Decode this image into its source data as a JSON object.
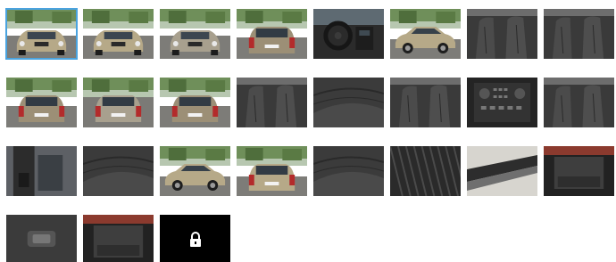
{
  "gallery": {
    "selected_index": 0,
    "thumbnails": [
      {
        "subject": "car-front-three-quarter",
        "scene": "exterior"
      },
      {
        "subject": "car-front-three-quarter",
        "scene": "exterior"
      },
      {
        "subject": "car-front",
        "scene": "exterior"
      },
      {
        "subject": "car-rear-three-quarter",
        "scene": "exterior"
      },
      {
        "subject": "dashboard-steering-wheel",
        "scene": "interior"
      },
      {
        "subject": "car-side-profile",
        "scene": "exterior"
      },
      {
        "subject": "rear-seats",
        "scene": "interior"
      },
      {
        "subject": "front-seats",
        "scene": "interior"
      },
      {
        "subject": "car-rear-three-quarter",
        "scene": "exterior"
      },
      {
        "subject": "car-rear",
        "scene": "exterior"
      },
      {
        "subject": "car-rear-three-quarter",
        "scene": "exterior"
      },
      {
        "subject": "cabin-from-rear",
        "scene": "interior"
      },
      {
        "subject": "door-seat-controls",
        "scene": "interior"
      },
      {
        "subject": "driver-seat",
        "scene": "interior"
      },
      {
        "subject": "center-console",
        "scene": "interior"
      },
      {
        "subject": "seats-closeup",
        "scene": "interior"
      },
      {
        "subject": "door-pillar",
        "scene": "interior"
      },
      {
        "subject": "seat-side-controls",
        "scene": "interior"
      },
      {
        "subject": "car-side-profile",
        "scene": "exterior"
      },
      {
        "subject": "car-rear-corner",
        "scene": "exterior"
      },
      {
        "subject": "leather-seat-closeup",
        "scene": "interior"
      },
      {
        "subject": "tire-tread",
        "scene": "detail"
      },
      {
        "subject": "roof-rail",
        "scene": "detail"
      },
      {
        "subject": "open-trunk",
        "scene": "exterior"
      },
      {
        "subject": "tailgate-button",
        "scene": "detail"
      },
      {
        "subject": "cargo-area",
        "scene": "interior"
      },
      {
        "subject": "locked",
        "scene": "locked"
      }
    ]
  },
  "colors": {
    "selected_outline": "#4aa3df",
    "locked_bg": "#000000",
    "lock_icon": "#ffffff"
  }
}
